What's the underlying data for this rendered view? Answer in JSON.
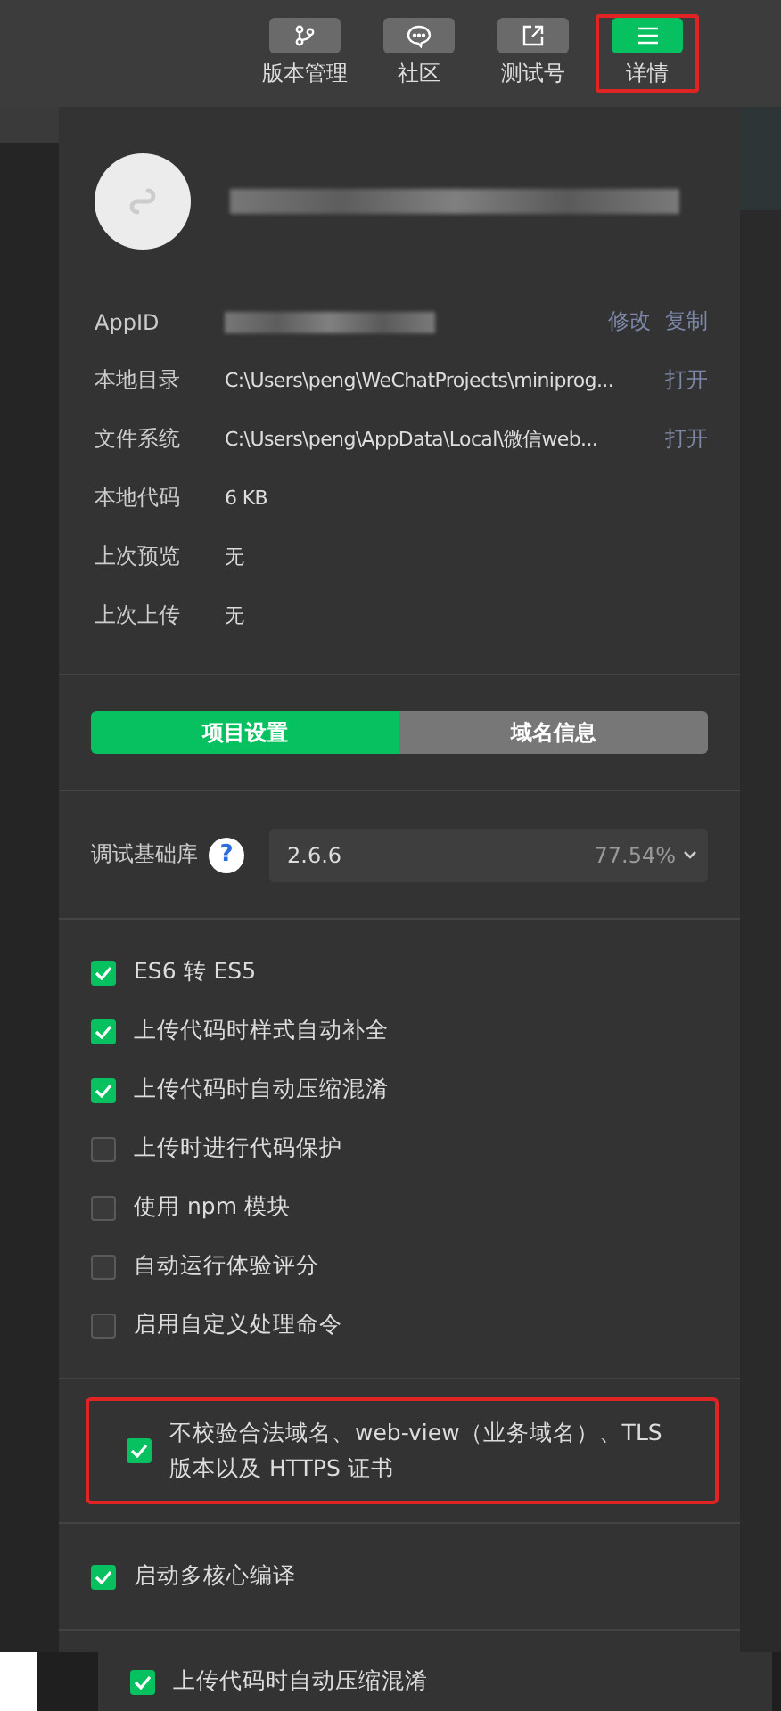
{
  "toolbar": {
    "buttons": [
      {
        "label": "版本管理",
        "selected": false,
        "highlighted": false
      },
      {
        "label": "社区",
        "selected": false,
        "highlighted": false
      },
      {
        "label": "测试号",
        "selected": false,
        "highlighted": false
      },
      {
        "label": "详情",
        "selected": true,
        "highlighted": true
      }
    ]
  },
  "project": {
    "info": [
      {
        "label": "AppID",
        "actions": [
          "修改",
          "复制"
        ]
      },
      {
        "label": "本地目录",
        "value": "C:\\Users\\peng\\WeChatProjects\\miniprog...",
        "actions": [
          "打开"
        ]
      },
      {
        "label": "文件系统",
        "value": "C:\\Users\\peng\\AppData\\Local\\微信web...",
        "actions": [
          "打开"
        ]
      },
      {
        "label": "本地代码",
        "value": "6 KB"
      },
      {
        "label": "上次预览",
        "value": "无"
      },
      {
        "label": "上次上传",
        "value": "无"
      }
    ]
  },
  "tabs": [
    {
      "label": "项目设置",
      "selected": true
    },
    {
      "label": "域名信息",
      "selected": false
    }
  ],
  "base_library": {
    "label": "调试基础库",
    "help": "?",
    "version": "2.6.6",
    "share": "77.54%"
  },
  "options": [
    {
      "label": "ES6 转 ES5",
      "checked": true
    },
    {
      "label": "上传代码时样式自动补全",
      "checked": true
    },
    {
      "label": "上传代码时自动压缩混淆",
      "checked": true
    },
    {
      "label": "上传时进行代码保护",
      "checked": false
    },
    {
      "label": "使用 npm 模块",
      "checked": false
    },
    {
      "label": "自动运行体验评分",
      "checked": false
    },
    {
      "label": "启用自定义处理命令",
      "checked": false
    }
  ],
  "security_option": {
    "label": "不校验合法域名、web-view（业务域名）、TLS 版本以及 HTTPS 证书",
    "checked": true,
    "highlighted": true
  },
  "compile_option": {
    "label": "启动多核心编译",
    "checked": true
  },
  "bottom_option": {
    "label": "上传代码时自动压缩混淆",
    "checked": true
  }
}
